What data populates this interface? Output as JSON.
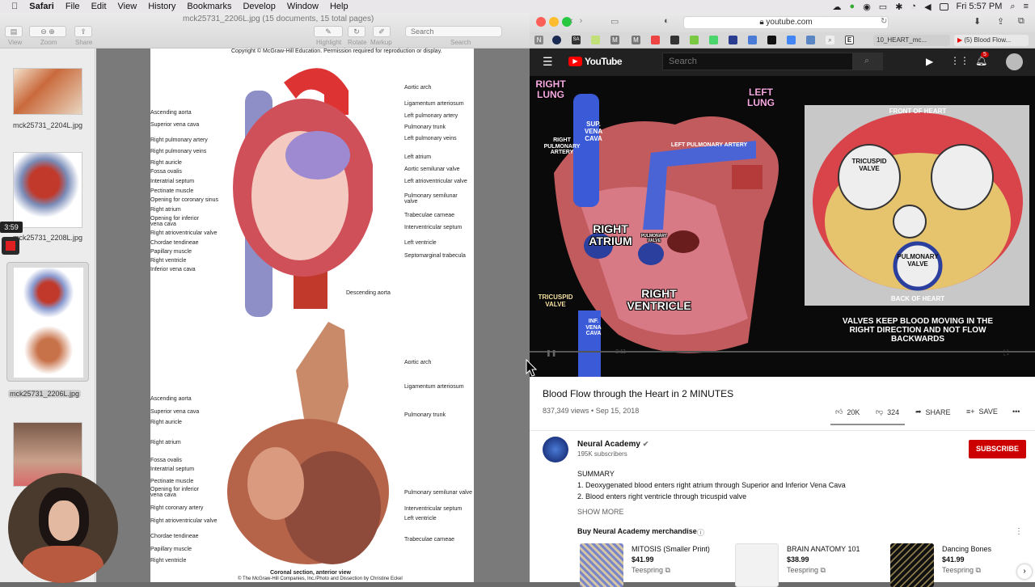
{
  "menubar": {
    "app": "Safari",
    "items": [
      "File",
      "Edit",
      "View",
      "History",
      "Bookmarks",
      "Develop",
      "Window",
      "Help"
    ],
    "clock": "Fri 5:57 PM"
  },
  "preview": {
    "title": "mck25731_2206L.jpg (15 documents, 15 total pages)",
    "toolbar": {
      "view": "View",
      "zoom": "Zoom",
      "share": "Share",
      "highlight": "Highlight",
      "rotate": "Rotate",
      "markup": "Markup",
      "search": "Search",
      "search_placeholder": "Search"
    },
    "thumbs": [
      "mck25731_2204L.jpg",
      "mck25731_2208L.jpg",
      "mck25731_2206L.jpg"
    ],
    "page": {
      "copyright_top": "Copyright © McGraw-Hill Education. Permission required for reproduction or display.",
      "left_labels_top": [
        "Ascending aorta",
        "Superior vena cava",
        "Right pulmonary artery",
        "Right pulmonary veins",
        "Right auricle",
        "Fossa ovalis",
        "Interatrial septum",
        "Pectinate muscle",
        "Opening for coronary sinus",
        "Right atrium",
        "Opening for inferior vena cava",
        "Right atrioventricular valve",
        "Chordae tendineae",
        "Papillary muscle",
        "Right ventricle",
        "Inferior vena cava"
      ],
      "right_labels_top": [
        "Aortic arch",
        "Ligamentum arteriosum",
        "Left pulmonary artery",
        "Pulmonary trunk",
        "Left pulmonary veins",
        "Left atrium",
        "Aortic semilunar valve",
        "Left atrioventricular valve",
        "Pulmonary semilunar valve",
        "Trabeculae carneae",
        "Interventricular septum",
        "Left ventricle",
        "Septomarginal trabecula"
      ],
      "descending_aorta": "Descending aorta",
      "left_labels_bottom": [
        "Ascending aorta",
        "Superior vena cava",
        "Right auricle",
        "Right atrium",
        "Fossa ovalis",
        "Interatrial septum",
        "Pectinate muscle",
        "Opening for inferior vena cava",
        "Right coronary artery",
        "Right atrioventricular valve",
        "Chordae tendineae",
        "Papillary muscle",
        "Right ventricle"
      ],
      "right_labels_bottom": [
        "Aortic arch",
        "Ligamentum arteriosum",
        "Pulmonary trunk",
        "Pulmonary semilunar valve",
        "Interventricular septum",
        "Left ventricle",
        "Trabeculae carneae"
      ],
      "caption": "Coronal section, anterior view",
      "caption_credit": "© The McGraw-Hill Companies, Inc./Photo and Dissection by Christine Eckel"
    },
    "timer": "3:59"
  },
  "safari": {
    "url": "youtube.com",
    "tabs": [
      "10_HEART_mc...",
      "(5) Blood Flow..."
    ],
    "bookmark_letters": [
      "N",
      "",
      "SA",
      "",
      "M",
      "M",
      "",
      "",
      "",
      "",
      "",
      "",
      "",
      "",
      "",
      "E"
    ]
  },
  "youtube": {
    "brand": "YouTube",
    "search_placeholder": "Search",
    "notif_count": "5",
    "video": {
      "right_lung": "RIGHT\nLUNG",
      "left_lung": "LEFT\nLUNG",
      "sup_vena_cava": "SUP.\nVENA\nCAVA",
      "right_pulm_artery": "RIGHT\nPULMONARY\nARTERY",
      "left_pulm_artery": "LEFT PULMONARY ARTERY",
      "pulm_artery": "PULMONARY ARTERY",
      "right_atrium": "RIGHT\nATRIUM",
      "pulmonary_valve_small": "PULMONARY\nVALVE",
      "right_ventricle": "RIGHT\nVENTRICLE",
      "tricuspid_valve": "TRICUSPID\nVALVE",
      "inf_vena_cava": "INF.\nVENA\nCAVA",
      "front_of_heart": "FRONT OF HEART",
      "tricuspid_valve_inset": "TRICUSPID\nVALVE",
      "pulmonary_valve_inset": "PULMONARY\nVALVE",
      "back_of_heart": "BACK OF HEART",
      "caption": "VALVES KEEP BLOOD MOVING IN THE RIGHT DIRECTION AND NOT FLOW BACKWARDS",
      "time_label": "2:11"
    },
    "title": "Blood Flow through the Heart in 2 MINUTES",
    "meta": "837,349 views • Sep 15, 2018",
    "likes": "20K",
    "dislikes": "324",
    "share": "SHARE",
    "save": "SAVE",
    "channel": "Neural Academy",
    "subscribers": "195K subscribers",
    "subscribe": "SUBSCRIBE",
    "description": [
      "SUMMARY",
      "1. Deoxygenated blood enters right atrium through Superior and Inferior Vena Cava",
      "2. Blood enters right ventricle through tricuspid valve"
    ],
    "show_more": "SHOW MORE",
    "merch_heading": "Buy Neural Academy merchandise",
    "merch": [
      {
        "name": "MITOSIS (Smaller Print)",
        "price": "$41.99",
        "seller": "Teespring"
      },
      {
        "name": "BRAIN ANATOMY 101",
        "price": "$38.99",
        "seller": "Teespring"
      },
      {
        "name": "Dancing Bones",
        "price": "$41.99",
        "seller": "Teespring"
      }
    ]
  }
}
